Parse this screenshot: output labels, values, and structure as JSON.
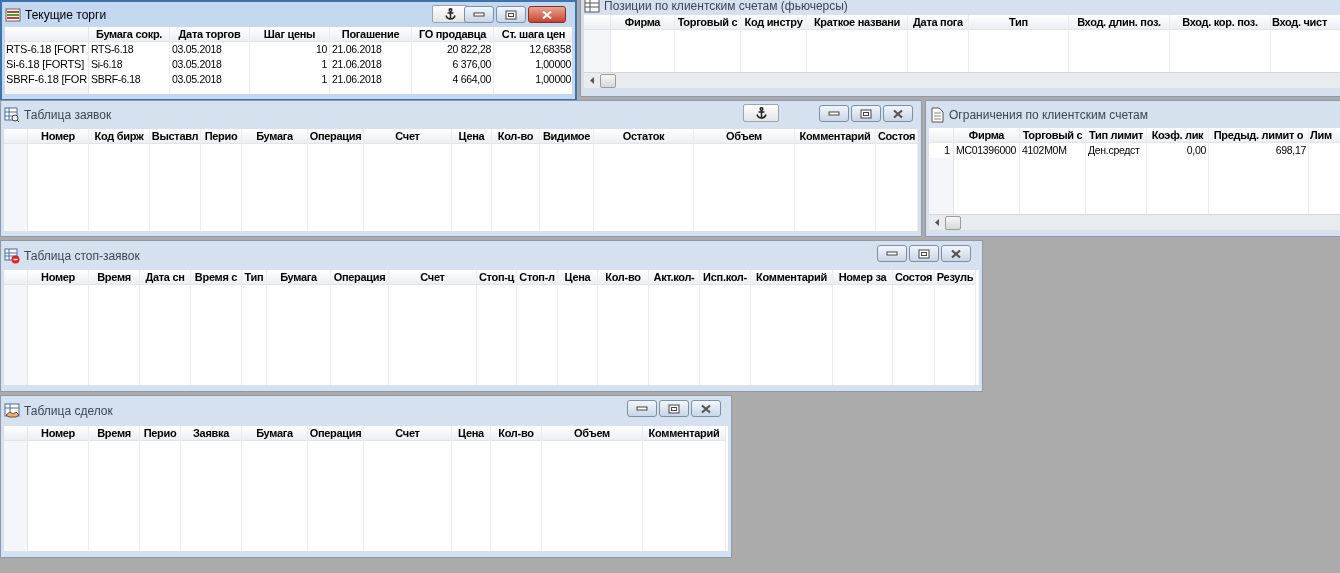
{
  "windows": [
    {
      "title": "Текущие торги",
      "active": true,
      "kind": "trades",
      "anchor_button": true,
      "window_buttons": true,
      "scrollbar": false,
      "columns": [
        "Бумага сокр.",
        "Дата торгов",
        "Шаг цены",
        "Погашение",
        "ГО продавца",
        "Ст. шага цен"
      ],
      "rows": [
        {
          "header": "RTS-6.18 [FORT",
          "cells": [
            "RTS-6.18",
            "03.05.2018",
            "10",
            "21.06.2018",
            "20 822,28",
            "12,68358"
          ]
        },
        {
          "header": "Si-6.18 [FORTS]",
          "cells": [
            "Si-6.18",
            "03.05.2018",
            "1",
            "21.06.2018",
            "6 376,00",
            "1,00000"
          ]
        },
        {
          "header": "SBRF-6.18 [FOR",
          "cells": [
            "SBRF-6.18",
            "03.05.2018",
            "1",
            "21.06.2018",
            "4 664,00",
            "1,00000"
          ]
        }
      ]
    },
    {
      "title": "Позиции по клиентским счетам (фьючерсы)",
      "active": false,
      "kind": "positions",
      "anchor_button": false,
      "window_buttons": false,
      "scrollbar": true,
      "columns": [
        "Фирма",
        "Торговый с",
        "Код инстру",
        "Краткое названи",
        "Дата пога",
        "Тип",
        "Вход. длин. поз.",
        "Вход. кор. поз.",
        "Вход. чист"
      ]
    },
    {
      "title": "Таблица заявок",
      "active": false,
      "kind": "orders",
      "anchor_button": true,
      "window_buttons": true,
      "scrollbar": false,
      "columns": [
        "Номер",
        "Код бирж",
        "Выставл",
        "Перио",
        "Бумага",
        "Операция",
        "Счет",
        "Цена",
        "Кол-во",
        "Видимое",
        "Остаток",
        "Объем",
        "Комментарий",
        "Состоя"
      ]
    },
    {
      "title": "Ограничения по клиентским счетам",
      "active": false,
      "kind": "limits",
      "anchor_button": false,
      "window_buttons": false,
      "scrollbar": true,
      "columns": [
        "Фирма",
        "Торговый с",
        "Тип лимит",
        "Коэф. лик",
        "Предыд. лимит о",
        "Лим"
      ],
      "rows": [
        {
          "header": "1",
          "cells": [
            "MC01396000",
            "4102M0M",
            "Ден.средст",
            "0,00",
            "698,17",
            ""
          ]
        }
      ]
    },
    {
      "title": "Таблица стоп-заявок",
      "active": false,
      "kind": "stop_orders",
      "anchor_button": false,
      "window_buttons": true,
      "scrollbar": false,
      "columns": [
        "Номер",
        "Время",
        "Дата сн",
        "Время с",
        "Тип",
        "Бумага",
        "Операция",
        "Счет",
        "Стоп-ц",
        "Стоп-л",
        "Цена",
        "Кол-во",
        "Акт.кол-",
        "Исп.кол-",
        "Комментарий",
        "Номер за",
        "Состоя",
        "Резуль"
      ]
    },
    {
      "title": "Таблица сделок",
      "active": false,
      "kind": "deals",
      "anchor_button": false,
      "window_buttons": true,
      "scrollbar": false,
      "columns": [
        "Номер",
        "Время",
        "Перио",
        "Заявка",
        "Бумага",
        "Операция",
        "Счет",
        "Цена",
        "Кол-во",
        "Объем",
        "Комментарий"
      ]
    }
  ]
}
